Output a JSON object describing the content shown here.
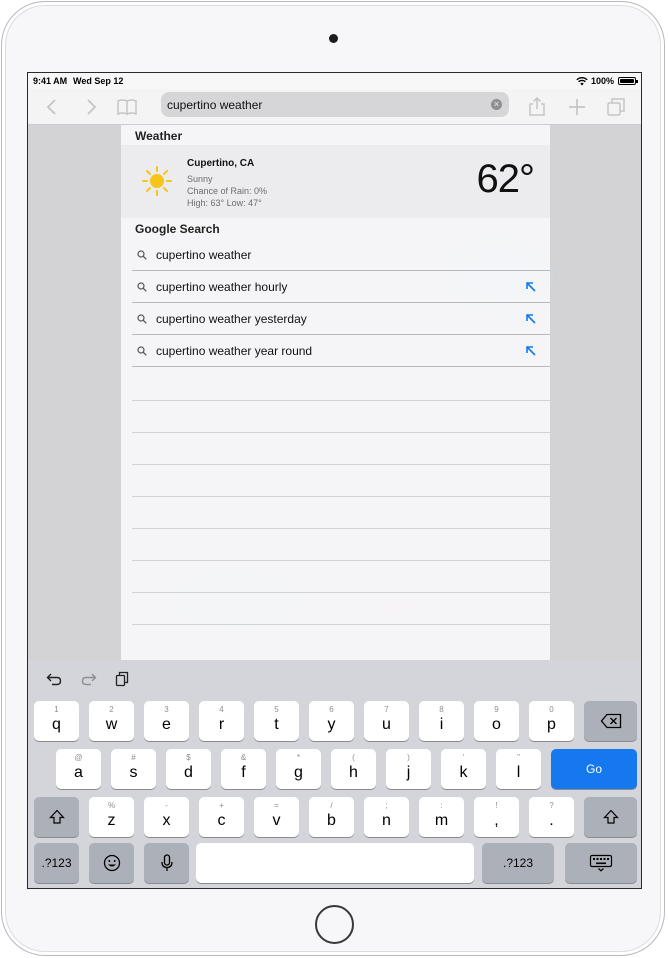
{
  "status_bar": {
    "time": "9:41 AM",
    "date": "Wed Sep 12",
    "battery": "100%"
  },
  "toolbar": {
    "address_value": "cupertino weather"
  },
  "weather": {
    "header": "Weather",
    "city": "Cupertino, CA",
    "condition": "Sunny",
    "rain": "Chance of Rain: 0%",
    "high_low": "High: 63° Low: 47°",
    "temperature": "62°"
  },
  "google": {
    "header": "Google Search",
    "suggestions": [
      "cupertino weather",
      "cupertino weather hourly",
      "cupertino weather yesterday",
      "cupertino weather year round"
    ]
  },
  "keyboard": {
    "row1": [
      [
        "1",
        "q"
      ],
      [
        "2",
        "w"
      ],
      [
        "3",
        "e"
      ],
      [
        "4",
        "r"
      ],
      [
        "5",
        "t"
      ],
      [
        "6",
        "y"
      ],
      [
        "7",
        "u"
      ],
      [
        "8",
        "i"
      ],
      [
        "9",
        "o"
      ],
      [
        "0",
        "p"
      ]
    ],
    "row2": [
      [
        "@",
        "a"
      ],
      [
        "#",
        "s"
      ],
      [
        "$",
        "d"
      ],
      [
        "&",
        "f"
      ],
      [
        "*",
        "g"
      ],
      [
        "(",
        "h"
      ],
      [
        ")",
        "j"
      ],
      [
        "'",
        "k"
      ],
      [
        "\"",
        "l"
      ]
    ],
    "row3": [
      [
        "%",
        "z"
      ],
      [
        "-",
        "x"
      ],
      [
        "+",
        "c"
      ],
      [
        "=",
        "v"
      ],
      [
        "/",
        "b"
      ],
      [
        ";",
        "n"
      ],
      [
        ":",
        "m"
      ],
      [
        "!",
        ","
      ],
      [
        "?",
        "."
      ]
    ],
    "go_label": "Go",
    "numbers_label": ".?123"
  },
  "colors": {
    "accent": "#1678ee",
    "sun": "#f7c419"
  }
}
